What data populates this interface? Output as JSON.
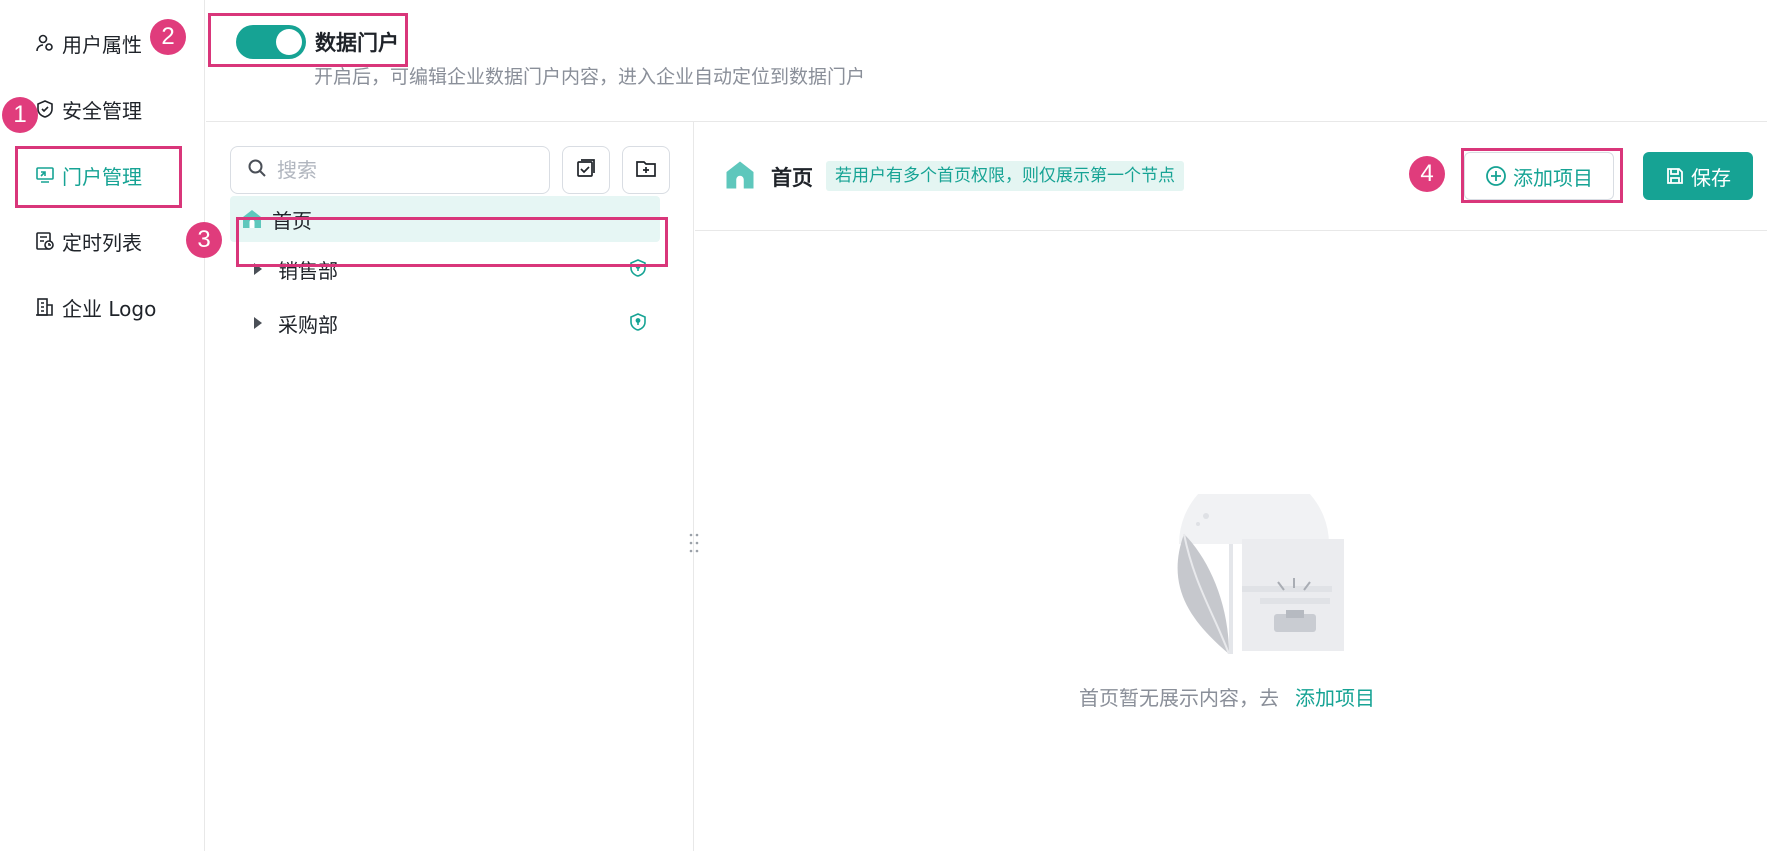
{
  "sidebar": {
    "items": [
      {
        "label": "用户属性",
        "icon": "user-attribute-icon"
      },
      {
        "label": "安全管理",
        "icon": "shield-check-icon"
      },
      {
        "label": "门户管理",
        "icon": "portal-icon",
        "active": true
      },
      {
        "label": "定时列表",
        "icon": "schedule-list-icon"
      },
      {
        "label": "企业 Logo",
        "icon": "building-icon"
      }
    ]
  },
  "header": {
    "toggle_on": true,
    "toggle_label": "数据门户",
    "description": "开启后，可编辑企业数据门户内容，进入企业自动定位到数据门户"
  },
  "tree": {
    "search_placeholder": "搜索",
    "items": [
      {
        "label": "首页",
        "selected": true
      },
      {
        "label": "销售部"
      },
      {
        "label": "采购部"
      }
    ]
  },
  "content": {
    "page_name": "首页",
    "hint": "若用户有多个首页权限，则仅展示第一个节点",
    "add_label": "添加项目",
    "save_label": "保存",
    "empty_text": "首页暂无展示内容，去",
    "empty_link": "添加项目"
  },
  "annotations": {
    "badges": [
      "1",
      "2",
      "3",
      "4"
    ]
  },
  "colors": {
    "accent": "#16a394",
    "annotation": "#e03c7c"
  }
}
